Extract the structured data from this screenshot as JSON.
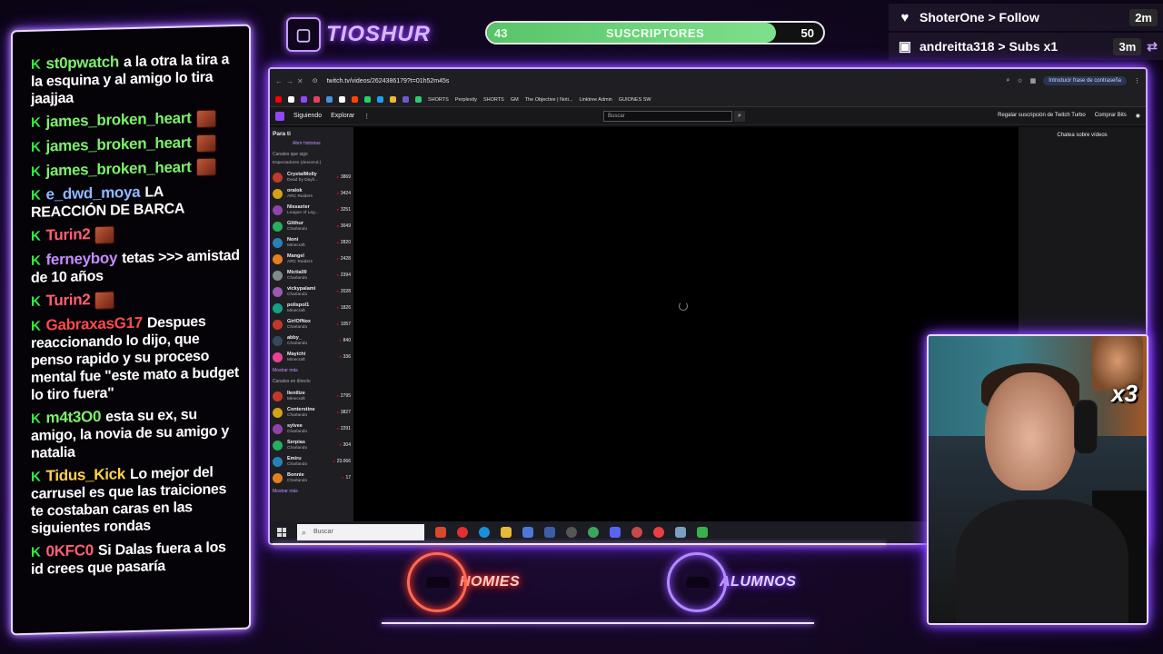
{
  "brand": {
    "icon": "twitch-icon",
    "name": "TIOSHUR"
  },
  "sub_goal": {
    "current": "43",
    "title": "SUSCRIPTORES",
    "goal": "50",
    "progress": 0.86,
    "color": "#6fd67e"
  },
  "events": [
    {
      "icon": "heart-icon",
      "glyph": "♥",
      "text": "ShoterOne > Follow",
      "time": "2m",
      "repeat": ""
    },
    {
      "icon": "gift-icon",
      "glyph": "🎁",
      "text": "andreitta318 > Subs x1",
      "time": "3m",
      "repeat": "⇄"
    }
  ],
  "chat": {
    "kick_glyph": "K",
    "messages": [
      {
        "user": "st0pwatch",
        "color": "#7cf06a",
        "text": "a la otra la tira a la esquina y al amigo lo tira jaajjaa",
        "emote": false
      },
      {
        "user": "james_broken_heart",
        "color": "#7cf06a",
        "text": "",
        "emote": true
      },
      {
        "user": "james_broken_heart",
        "color": "#7cf06a",
        "text": "",
        "emote": true
      },
      {
        "user": "james_broken_heart",
        "color": "#7cf06a",
        "text": "",
        "emote": true
      },
      {
        "user": "e_dwd_moya",
        "color": "#8fb8ff",
        "text": "LA REACCIÓN DE BARCA",
        "emote": false
      },
      {
        "user": "Turin2",
        "color": "#ff6070",
        "text": "",
        "emote": true
      },
      {
        "user": "ferneyboy",
        "color": "#c58cff",
        "text": "tetas >>> amistad de 10 años",
        "emote": false
      },
      {
        "user": "Turin2",
        "color": "#ff6070",
        "text": "",
        "emote": true
      },
      {
        "user": "GabraxasG17",
        "color": "#ff4a4a",
        "text": "Despues reaccionando lo dijo, que penso rapido y su proceso mental fue \"este mato a budget lo tiro fuera\"",
        "emote": false
      },
      {
        "user": "m4t3O0",
        "color": "#7cf06a",
        "text": "esta su ex, su amigo, la novia de su amigo y natalia",
        "emote": false
      },
      {
        "user": "Tidus_Kick",
        "color": "#ffd24a",
        "text": "Lo mejor del carrusel es que las traiciones te costaban caras en las siguientes rondas",
        "emote": false
      },
      {
        "user": "0KFC0",
        "color": "#ff6070",
        "text": "Si Dalas fuera a los id crees que pasaría",
        "emote": false
      }
    ]
  },
  "browser": {
    "url": "twitch.tv/videos/2624386179?t=01h52m45s",
    "password_prompt": "Introducir frase de contraseña",
    "bookmarks": [
      "SHORTS",
      "Perplexity",
      "SHORTS",
      "GM",
      "The Objective | Noti...",
      "Linktree Admin",
      "GUIONES SW"
    ],
    "twitch": {
      "nav_following": "Siguiendo",
      "nav_browse": "Explorar",
      "search_placeholder": "Buscar",
      "turbo": "Regalar suscripción de Twitch Turbo",
      "bits": "Comprar Bits",
      "chat_header": "Chatea sobre vídeos",
      "sidebar_title": "Para ti",
      "open_stories": "Abrir historias",
      "followed_header": "Canales que sigo",
      "followed_sort": "Espectadores (descend.)",
      "followed": [
        {
          "name": "CrystalMolly",
          "cat": "Dead by Dayli...",
          "viewers": "3869"
        },
        {
          "name": "oralok",
          "cat": "ARC Raiders",
          "viewers": "3424"
        },
        {
          "name": "Nissaxter",
          "cat": "League of Leg...",
          "viewers": "3251"
        },
        {
          "name": "Glithur",
          "cat": "Charlando",
          "viewers": "3049"
        },
        {
          "name": "Noni",
          "cat": "Minecraft",
          "viewers": "2820"
        },
        {
          "name": "Mangel",
          "cat": "ARC Raiders",
          "viewers": "2428"
        },
        {
          "name": "Mictia00",
          "cat": "Charlando",
          "viewers": "2394"
        },
        {
          "name": "vickypalami",
          "cat": "Charlando",
          "viewers": "2028"
        },
        {
          "name": "polispol1",
          "cat": "Minecraft",
          "viewers": "1826"
        },
        {
          "name": "GirlOfNox",
          "cat": "Charlando",
          "viewers": "1057"
        },
        {
          "name": "abby_",
          "cat": "Charlando",
          "viewers": "840"
        },
        {
          "name": "Mayichi",
          "cat": "Minecraft",
          "viewers": "336"
        }
      ],
      "show_more": "Mostrar más",
      "live_header": "Canales en directo",
      "live": [
        {
          "name": "Ilenilize",
          "cat": "Minecraft",
          "viewers": "2795"
        },
        {
          "name": "Conterstine",
          "cat": "Charlando",
          "viewers": "3827"
        },
        {
          "name": "sylvee",
          "cat": "Charlando",
          "viewers": "2291"
        },
        {
          "name": "Serpias",
          "cat": "Charlando",
          "viewers": "304"
        },
        {
          "name": "Emiru",
          "cat": "Charlando",
          "viewers": "23.066"
        },
        {
          "name": "Bonnie",
          "cat": "Charlando",
          "viewers": "17"
        }
      ],
      "show_more_live": "Mostrar más"
    },
    "taskbar_search": "Buscar"
  },
  "teams": [
    {
      "name": "HOMIES",
      "color": "#ff4a35"
    },
    {
      "name": "ALUMNOS",
      "color": "#9a5dff"
    }
  ],
  "webcam": {
    "overlay_text": "x3"
  }
}
